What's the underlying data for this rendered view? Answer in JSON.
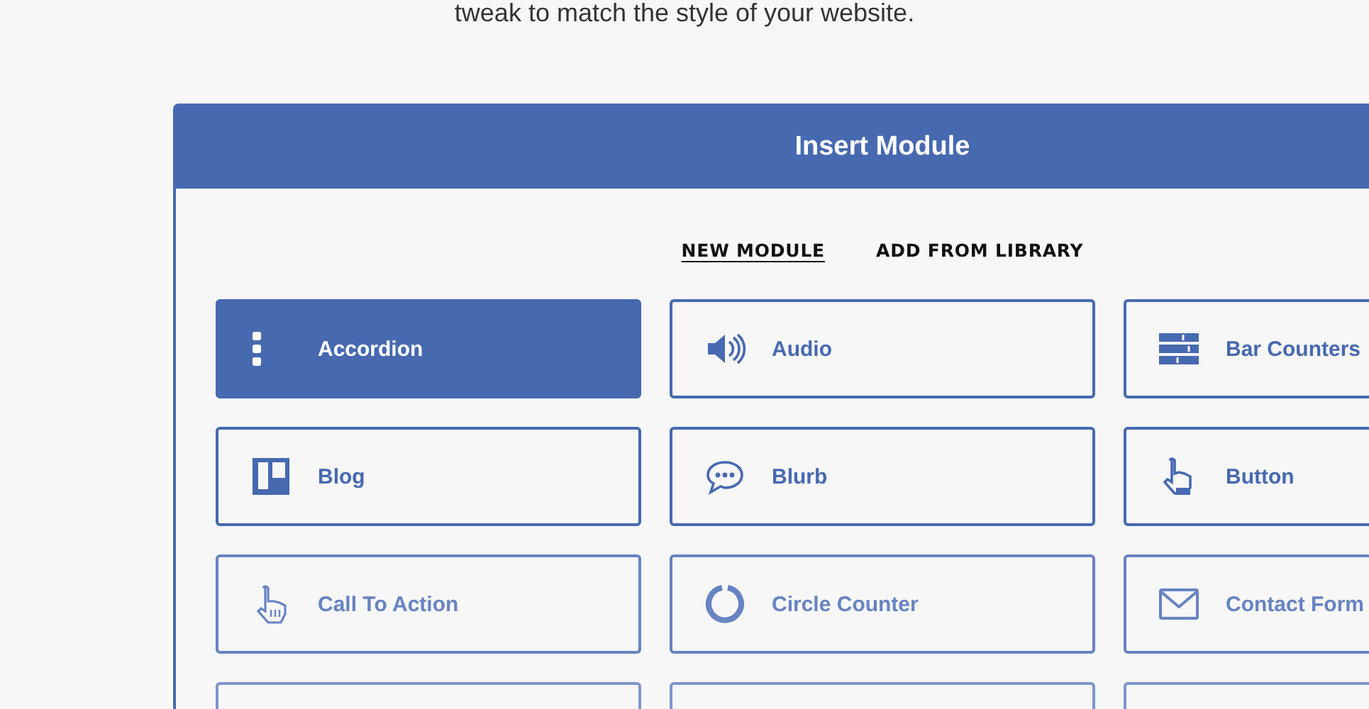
{
  "intro": {
    "text": "tweak to match the style of your website."
  },
  "modal": {
    "title": "Insert Module",
    "tabs": [
      {
        "label": "NEW MODULE",
        "selected": true
      },
      {
        "label": "ADD FROM LIBRARY",
        "selected": false
      }
    ],
    "modules": [
      {
        "label": "Accordion",
        "selected": true
      },
      {
        "label": "Audio",
        "selected": false
      },
      {
        "label": "Bar Counters",
        "selected": false
      },
      {
        "label": "Blog",
        "selected": false
      },
      {
        "label": "Blurb",
        "selected": false
      },
      {
        "label": "Button",
        "selected": false
      },
      {
        "label": "Call To Action",
        "selected": false
      },
      {
        "label": "Circle Counter",
        "selected": false
      },
      {
        "label": "Contact Form",
        "selected": false
      }
    ]
  }
}
